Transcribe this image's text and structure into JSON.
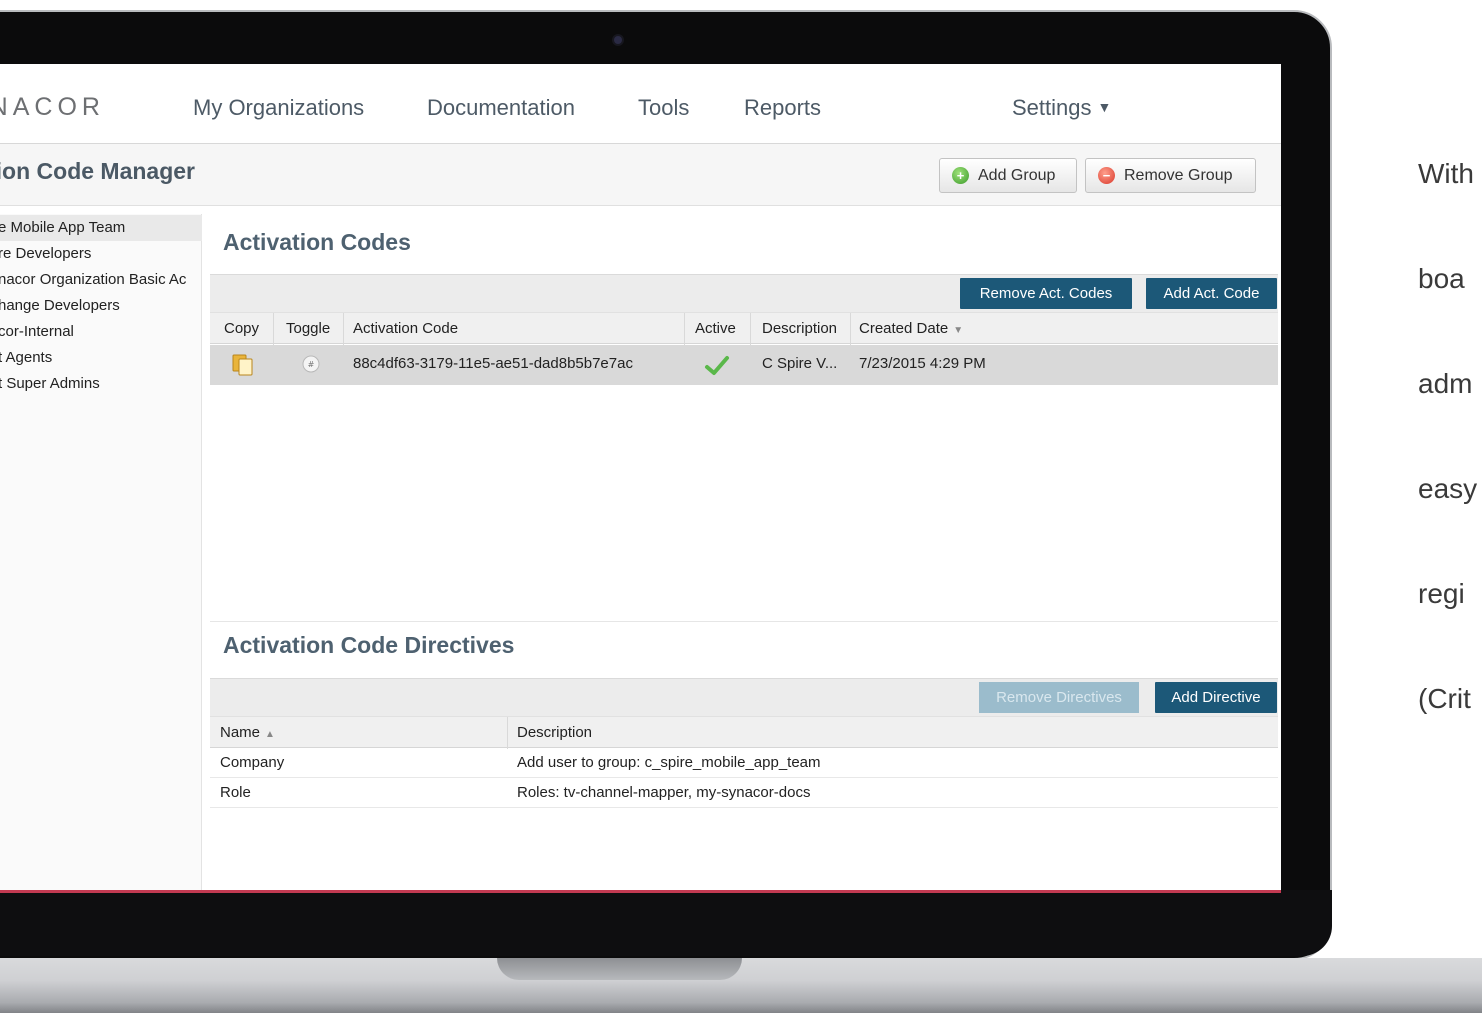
{
  "caption_lines": [
    "With",
    "boa",
    "adm",
    "easy",
    "regi",
    "(Crit"
  ],
  "nav": {
    "logo": "YNACOR",
    "items": [
      "My Organizations",
      "Documentation",
      "Tools",
      "Reports"
    ],
    "settings": "Settings"
  },
  "page": {
    "title": "tion Code Manager",
    "add_group": "Add Group",
    "remove_group": "Remove Group"
  },
  "sidebar": {
    "items": [
      "e Mobile App Team",
      "re Developers",
      "nacor Organization Basic Ac",
      "hange Developers",
      "cor-Internal",
      "t Agents",
      "t Super Admins"
    ]
  },
  "codes": {
    "title": "Activation Codes",
    "remove_btn": "Remove Act. Codes",
    "add_btn": "Add Act. Code",
    "columns": [
      "Copy",
      "Toggle",
      "Activation Code",
      "Active",
      "Description",
      "Created Date"
    ],
    "rows": [
      {
        "code": "88c4df63-3179-11e5-ae51-dad8b5b7e7ac",
        "description": "C Spire V...",
        "created": "7/23/2015 4:29 PM"
      }
    ]
  },
  "directives": {
    "title": "Activation Code Directives",
    "remove_btn": "Remove Directives",
    "add_btn": "Add Directive",
    "columns": [
      "Name",
      "Description"
    ],
    "rows": [
      {
        "name": "Company",
        "description": "Add user to group: c_spire_mobile_app_team"
      },
      {
        "name": "Role",
        "description": "Roles: tv-channel-mapper, my-synacor-docs"
      }
    ]
  },
  "colors": {
    "accent": "#1c5878",
    "disabled": "#9bbccc",
    "section_title": "#4e6170"
  }
}
